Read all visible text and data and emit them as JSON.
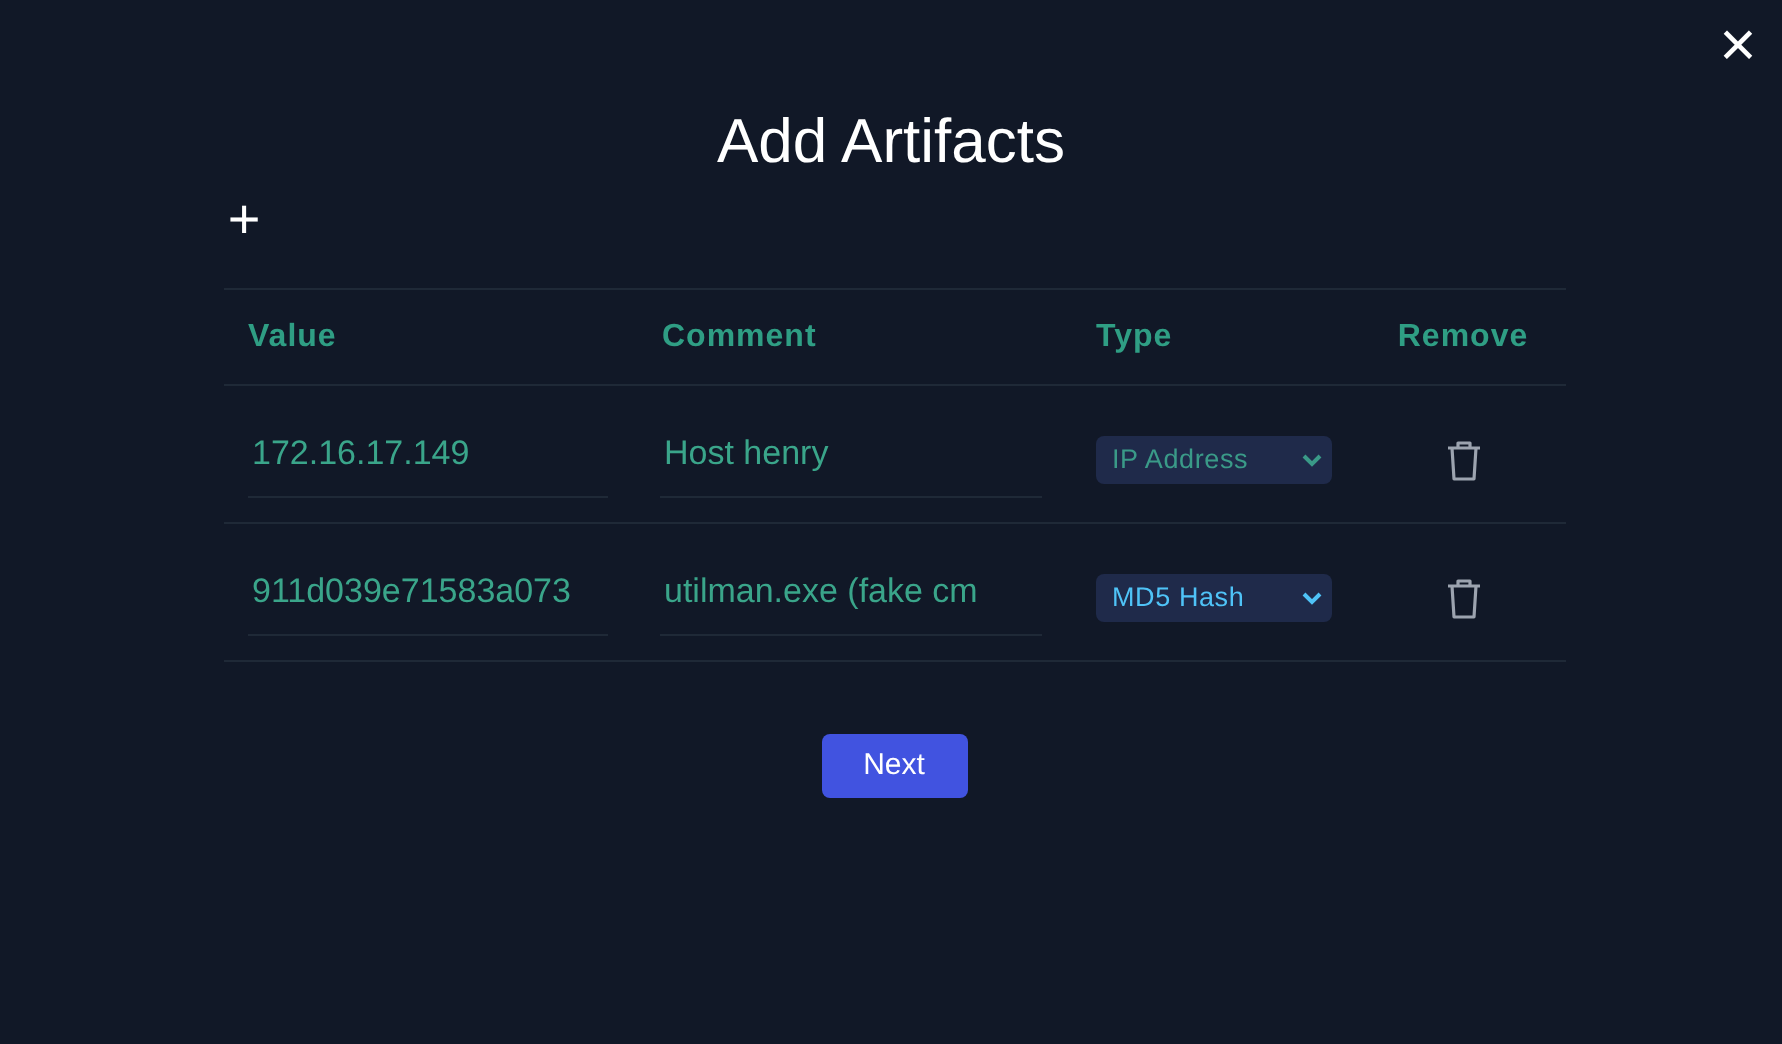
{
  "dialog": {
    "title": "Add Artifacts",
    "close": "×",
    "add": "+"
  },
  "table": {
    "columns": [
      "Value",
      "Comment",
      "Type",
      "Remove"
    ],
    "rows": [
      {
        "value": "172.16.17.149",
        "comment": "Host henry",
        "type": "IP Address",
        "active": false
      },
      {
        "value": "911d039e71583a073",
        "comment": "utilman.exe (fake cm",
        "type": "MD5 Hash",
        "active": true
      }
    ]
  },
  "next_button": "Next"
}
